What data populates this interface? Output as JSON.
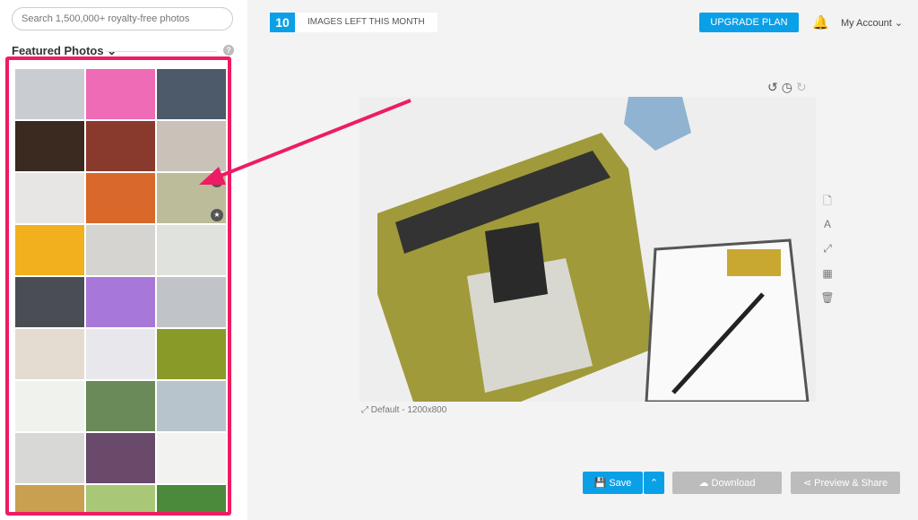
{
  "sidebar": {
    "search_placeholder": "Search 1,500,000+ royalty-free photos",
    "featured_label": "Featured Photos",
    "featured_chevron": "⌄",
    "help": "?",
    "thumbs": [
      "#c9ccd0",
      "#f06bb5",
      "#4c5a6a",
      "#3a2a20",
      "#8a3a2c",
      "#c8c2b8",
      "#e8e6e4",
      "#d8692a",
      "#bcbc9a",
      "#f2b01e",
      "#d6d4d0",
      "#e0e2de",
      "#4a4e54",
      "#a878d8",
      "#c0c4c8",
      "#e4dcd0",
      "#e8e8ec",
      "#8a9a28",
      "#f0f2ee",
      "#6a8a5a",
      "#b8c4cc",
      "#d8d8d6",
      "#6a4a6a",
      "#f2f2f0",
      "#c8a050",
      "#a8c878",
      "#4a8a3a"
    ]
  },
  "topbar": {
    "images_left": "10",
    "images_left_label": "IMAGES LEFT THIS MONTH",
    "upgrade": "UPGRADE PLAN",
    "account": "My Account ⌄"
  },
  "canvas": {
    "size_label": "⤢ Default - 1200x800"
  },
  "actions": {
    "save": "💾 Save",
    "save_more": "⌃",
    "download": "☁ Download",
    "preview": "⋖ Preview & Share"
  },
  "colors": {
    "accent": "#0aa0e8",
    "highlight": "#ee1c64",
    "disabled": "#bcbcbc"
  }
}
